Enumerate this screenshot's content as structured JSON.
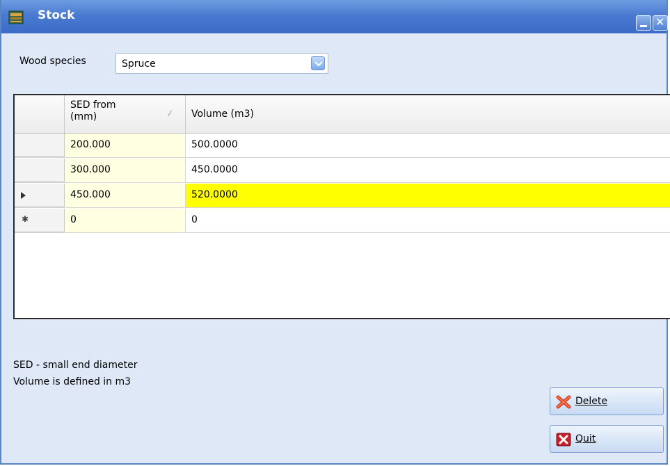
{
  "window": {
    "title": "Stock",
    "icons": [
      "window-app-icon",
      "minimize-icon",
      "close-icon"
    ]
  },
  "wood_species": {
    "label": "Wood species",
    "selected": "Spruce"
  },
  "grid": {
    "headers": {
      "sed": "SED from (mm)",
      "volume": "Volume (m3)"
    },
    "rows": [
      {
        "marker": "",
        "sed": "200.000",
        "volume": "500.0000"
      },
      {
        "marker": "",
        "sed": "300.000",
        "volume": "450.0000"
      },
      {
        "marker": "current-row-arrow",
        "sed": "450.000",
        "volume": "520.0000"
      },
      {
        "marker": "new-row-asterisk",
        "sed": "0",
        "volume": "0"
      }
    ]
  },
  "info": {
    "line1": "SED - small end diameter",
    "line2": "Volume is defined in m3"
  },
  "buttons": {
    "delete": "Delete",
    "quit": "Quit"
  },
  "colors": {
    "titlebar": "#4a7bd0",
    "window_bg": "#dfe8f6",
    "sed_cell_bg": "#ffffe1",
    "active_cell_bg": "#ffff00"
  }
}
